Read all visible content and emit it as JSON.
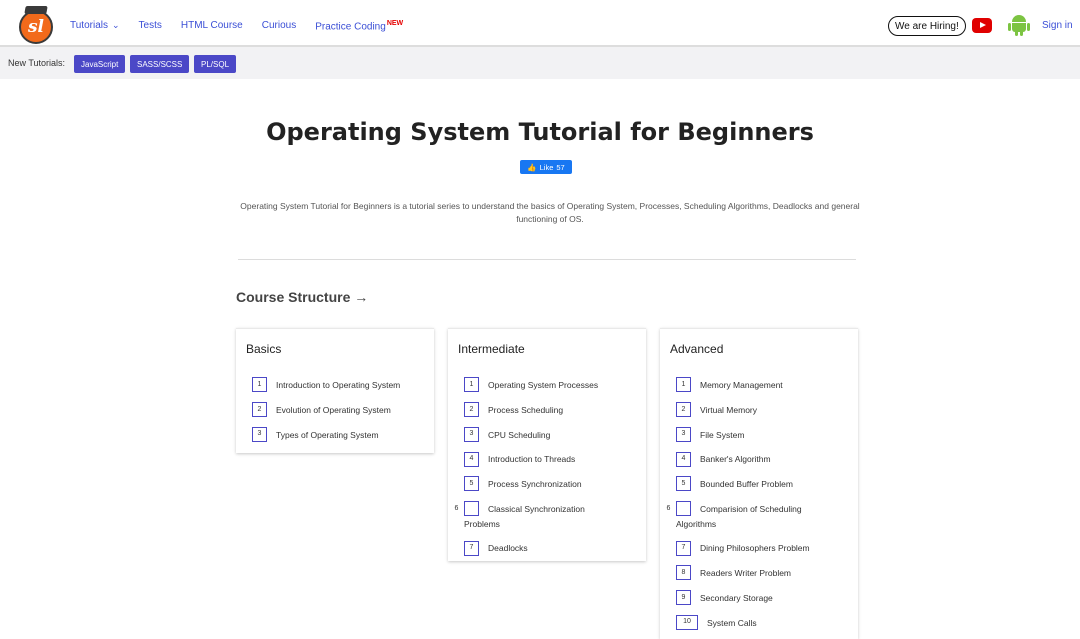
{
  "nav": {
    "logo": "sl",
    "links": [
      {
        "label": "Tutorials",
        "has_dropdown": true
      },
      {
        "label": "Tests"
      },
      {
        "label": "HTML Course"
      },
      {
        "label": "Curious"
      },
      {
        "label": "Practice Coding",
        "badge": "NEW"
      }
    ],
    "hiring": "We are Hiring!",
    "signin": "Sign in"
  },
  "new_tutorials": {
    "label": "New Tutorials:",
    "items": [
      "JavaScript",
      "SASS/SCSS",
      "PL/SQL"
    ]
  },
  "hero": {
    "title": "Operating System Tutorial for Beginners",
    "like_label": "Like",
    "like_count": "57",
    "description": "Operating System Tutorial for Beginners is a tutorial series to understand the basics of Operating System, Processes, Scheduling Algorithms, Deadlocks and general functioning of OS."
  },
  "course": {
    "heading": "Course Structure →",
    "sections": [
      {
        "title": "Basics",
        "items": [
          {
            "n": "1",
            "label": "Introduction to Operating System"
          },
          {
            "n": "2",
            "label": "Evolution of Operating System"
          },
          {
            "n": "3",
            "label": "Types of Operating System"
          }
        ]
      },
      {
        "title": "Intermediate",
        "items": [
          {
            "n": "1",
            "label": "Operating System Processes"
          },
          {
            "n": "2",
            "label": "Process Scheduling"
          },
          {
            "n": "3",
            "label": "CPU Scheduling"
          },
          {
            "n": "4",
            "label": "Introduction to Threads"
          },
          {
            "n": "5",
            "label": "Process Synchronization"
          },
          {
            "n": "6",
            "label": "Classical Synchronization Problems"
          },
          {
            "n": "7",
            "label": "Deadlocks"
          }
        ]
      },
      {
        "title": "Advanced",
        "items": [
          {
            "n": "1",
            "label": "Memory Management"
          },
          {
            "n": "2",
            "label": "Virtual Memory"
          },
          {
            "n": "3",
            "label": "File System"
          },
          {
            "n": "4",
            "label": "Banker's Algorithm"
          },
          {
            "n": "5",
            "label": "Bounded Buffer Problem"
          },
          {
            "n": "6",
            "label": "Comparision of Scheduling Algorithms"
          },
          {
            "n": "7",
            "label": "Dining Philosophers Problem"
          },
          {
            "n": "8",
            "label": "Readers Writer Problem"
          },
          {
            "n": "9",
            "label": "Secondary Storage"
          },
          {
            "n": "10",
            "label": "System Calls"
          }
        ]
      }
    ]
  },
  "colors": {
    "accent": "#4b48c7",
    "link": "#3b4fd6",
    "logo_orange": "#f26a1b",
    "youtube_red": "#e00000",
    "android_green": "#7cc442",
    "facebook_blue": "#1877f2"
  }
}
